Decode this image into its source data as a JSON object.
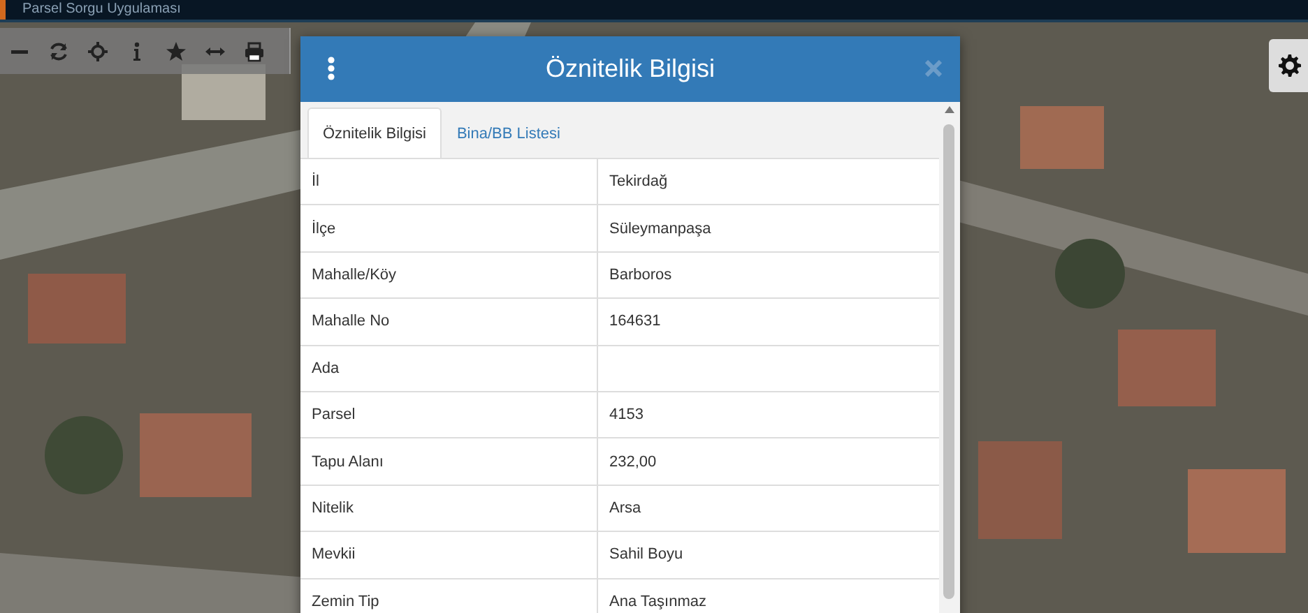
{
  "app_bar": {
    "title": "Parsel Sorgu Uygulaması"
  },
  "dialog": {
    "title": "Öznitelik Bilgisi",
    "tabs": [
      {
        "label": "Öznitelik Bilgisi",
        "selected": true
      },
      {
        "label": "Bina/BB Listesi",
        "selected": false
      }
    ],
    "rows": [
      {
        "label": "İl",
        "value": "Tekirdağ"
      },
      {
        "label": "İlçe",
        "value": "Süleymanpaşa"
      },
      {
        "label": "Mahalle/Köy",
        "value": "Barboros"
      },
      {
        "label": "Mahalle No",
        "value": "164631"
      },
      {
        "label": "Ada"
      },
      {
        "label": "Parsel",
        "value": "4153"
      },
      {
        "label": "Tapu Alanı",
        "value": "232,00"
      },
      {
        "label": "Nitelik",
        "value": "Arsa"
      },
      {
        "label": "Mevkii",
        "value": "Sahil Boyu"
      },
      {
        "label": "Zemin Tip",
        "value": "Ana Taşınmaz"
      }
    ]
  }
}
